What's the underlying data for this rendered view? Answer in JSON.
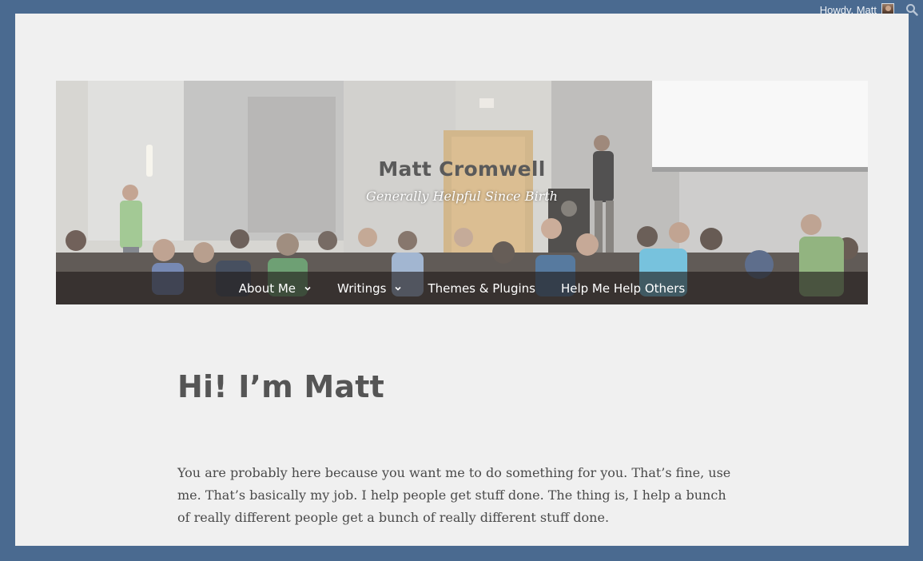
{
  "admin_bar": {
    "greeting": "Howdy, Matt",
    "avatar_icon": "user-avatar",
    "search_icon": "search-icon"
  },
  "site": {
    "title": "Matt Cromwell",
    "description": "Generally Helpful Since Birth"
  },
  "nav": {
    "items": [
      {
        "label": "About Me",
        "has_submenu": true
      },
      {
        "label": "Writings",
        "has_submenu": true
      },
      {
        "label": "Themes & Plugins",
        "has_submenu": false
      },
      {
        "label": "Help Me Help Others",
        "has_submenu": false
      }
    ]
  },
  "page": {
    "title": "Hi! I’m Matt",
    "paragraph": "You are probably here because you want me to do something for you. That’s fine, use me. That’s basically my job. I help people get stuff done. The thing is, I help a bunch of really different people get a bunch of really different stuff done."
  },
  "colors": {
    "frame": "#4a6a90",
    "page_background": "#f0f0f0",
    "title_text": "#555555",
    "body_text": "#4a4a4a",
    "nav_text": "#ffffff"
  }
}
